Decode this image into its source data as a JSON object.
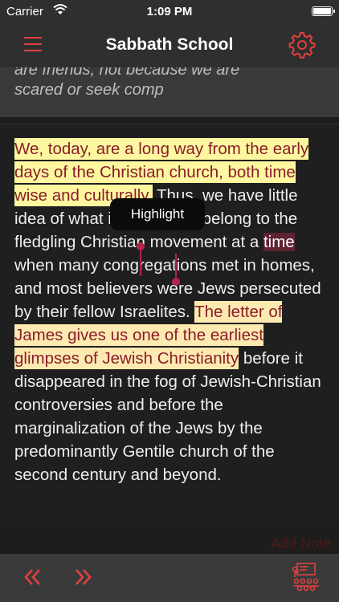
{
  "status_bar": {
    "carrier": "Carrier",
    "time": "1:09 PM"
  },
  "nav": {
    "title": "Sabbath School",
    "menu_icon": "hamburger-menu-icon",
    "settings_icon": "gear-icon"
  },
  "previous_text": {
    "line1": "are friends, not because we are",
    "line2": "scared or seek comp"
  },
  "paragraph": {
    "highlight1": "We, today, are a long way from the early days of the Christian church, both time wise and culturally.",
    "text1": " Thus, we have little idea of what it was like to belong to the fledgling Christian movement at a ",
    "selected_word": "time",
    "text2": " when many congregations met in homes, and most believers were Jews persecuted by their fellow Israelites. ",
    "highlight2": "The letter of James gives us one of the earliest glimpses of Jewish Christianity",
    "text3": " before it disappeared in the fog of Jewish-Christian controversies and before the marginalization of the Jews by the predominantly Gentile church of the second century and beyond."
  },
  "tooltip": {
    "label": "Highlight"
  },
  "add_note": {
    "label": "Add Note"
  },
  "bottom_bar": {
    "prev_icon": "double-chevron-left-icon",
    "next_icon": "double-chevron-right-icon",
    "lesson_icon": "classroom-icon"
  },
  "colors": {
    "accent": "#e0413f",
    "highlight_yellow": "#fdf8a0",
    "highlight_orange": "#fdeab0",
    "highlight_text": "#8a1c2c",
    "selection_handle": "#b3234a"
  }
}
